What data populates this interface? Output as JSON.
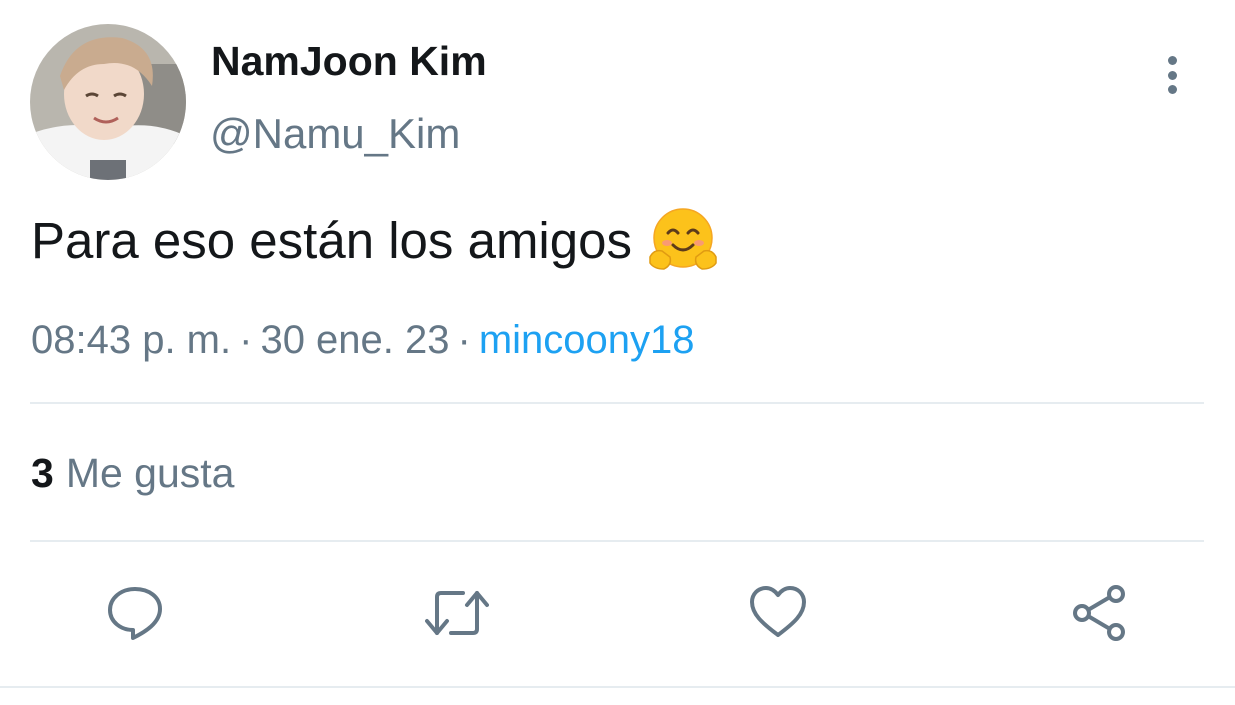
{
  "tweet": {
    "display_name": "NamJoon Kim",
    "handle": "@Namu_Kim",
    "text": "Para eso están los amigos",
    "emoji": "hugging-face",
    "time": "08:43 p. m.",
    "separator": "·",
    "date": "30 ene. 23",
    "source": "mincoony18"
  },
  "stats": {
    "likes_count": "3",
    "likes_label": "Me gusta"
  },
  "actions": [
    {
      "icon": "reply-icon"
    },
    {
      "icon": "retweet-icon"
    },
    {
      "icon": "like-icon"
    },
    {
      "icon": "share-icon"
    }
  ],
  "colors": {
    "primary_text": "#14171a",
    "secondary_text": "#657786",
    "link": "#1da1f2",
    "divider": "#e6ecf0"
  }
}
